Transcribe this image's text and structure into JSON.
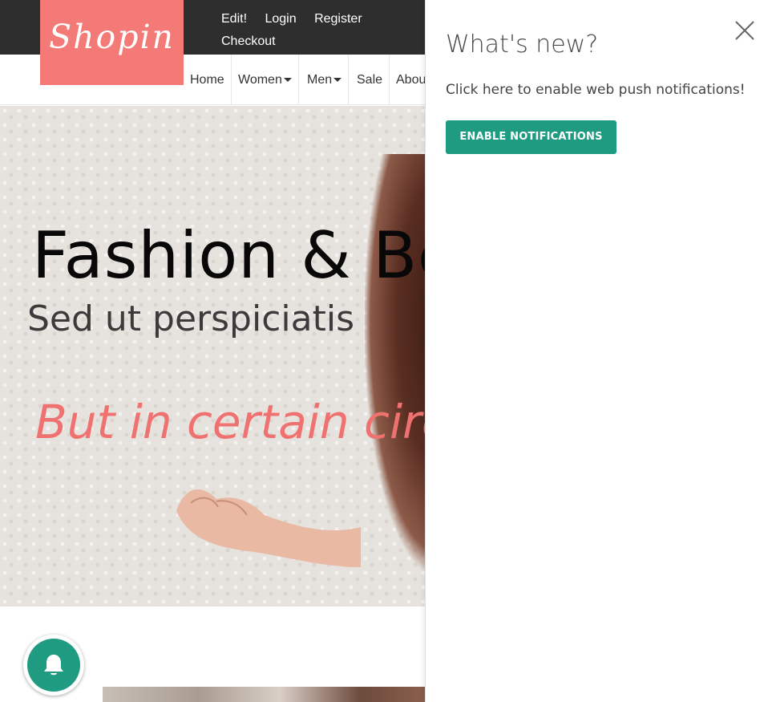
{
  "site": {
    "logo": "Shopin",
    "top_links": [
      "Edit!",
      "Login",
      "Register",
      "Checkout"
    ],
    "nav": [
      {
        "label": "Home",
        "dropdown": false
      },
      {
        "label": "Women",
        "dropdown": true
      },
      {
        "label": "Men",
        "dropdown": true
      },
      {
        "label": "Sale",
        "dropdown": false
      },
      {
        "label": "About",
        "dropdown": false
      }
    ]
  },
  "hero": {
    "title": "Fashion & Beauty",
    "subtitle": "Sed ut perspiciatis",
    "tagline": "But in certain circumstances"
  },
  "panel": {
    "title": "What's new?",
    "message": "Click here to enable web push notifications!",
    "button_label": "ENABLE NOTIFICATIONS"
  },
  "colors": {
    "brand": "#f47a78",
    "accent": "#1f9b81",
    "topbar": "#2e2e2e"
  },
  "icons": {
    "close": "close-icon",
    "bell": "bell-icon"
  }
}
